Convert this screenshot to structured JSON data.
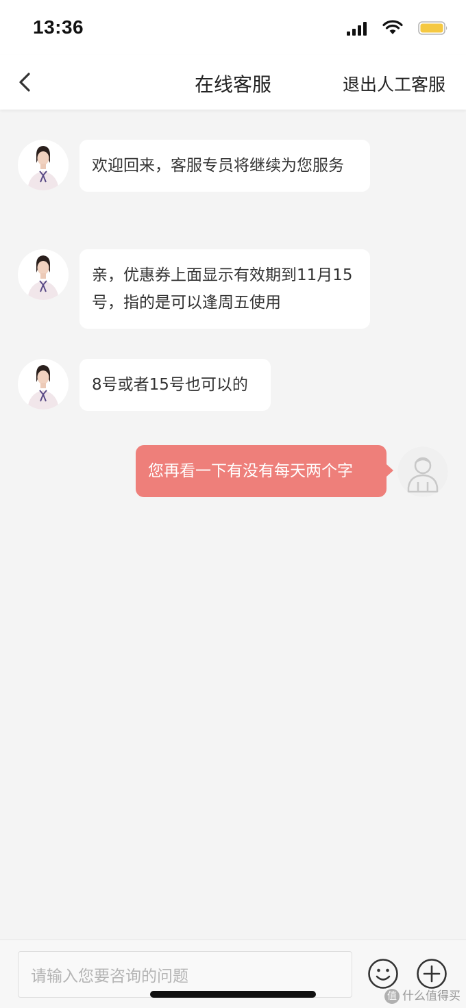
{
  "status_bar": {
    "time": "13:36",
    "icons": [
      "signal-icon",
      "wifi-icon",
      "battery-icon"
    ],
    "battery_color": "#f5c842"
  },
  "nav": {
    "back_icon": "chevron-left-icon",
    "title": "在线客服",
    "exit_label": "退出人工客服"
  },
  "messages": [
    {
      "from": "agent",
      "text": "欢迎回来，客服专员将继续为您服务"
    },
    {
      "from": "agent",
      "text": "亲，优惠券上面显示有效期到11月15号，指的是可以逢周五使用"
    },
    {
      "from": "agent",
      "text": "8号或者15号也可以的"
    },
    {
      "from": "user",
      "text": "您再看一下有没有每天两个字"
    }
  ],
  "input": {
    "placeholder": "请输入您要咨询的问题",
    "emoji_icon": "emoji-icon",
    "plus_icon": "plus-circle-icon"
  },
  "colors": {
    "user_bubble": "#ee7f7a",
    "agent_bubble": "#ffffff",
    "background": "#f4f4f4"
  },
  "watermark": {
    "logo": "值",
    "text": "什么值得买"
  }
}
